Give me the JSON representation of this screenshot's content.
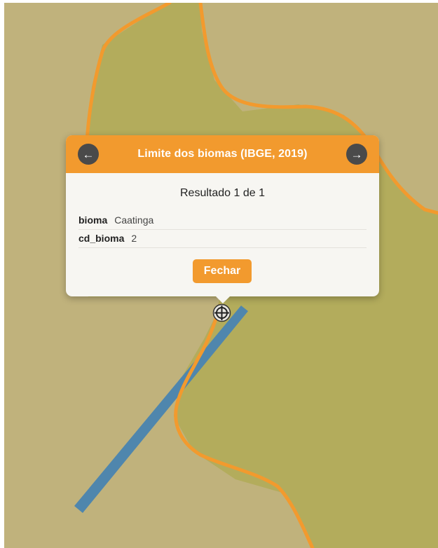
{
  "map": {
    "colors": {
      "background": "#c0b27c",
      "biome_fill": "#b3ac5c",
      "biome_border": "#f29a2e",
      "river": "#4f86ad"
    },
    "marker_icon": "target-crosshair-icon"
  },
  "popup": {
    "title": "Limite dos biomas (IBGE, 2019)",
    "prev_icon": "arrow-left-icon",
    "next_icon": "arrow-right-icon",
    "prev_glyph": "←",
    "next_glyph": "→",
    "result_count": "Resultado 1 de 1",
    "attributes": [
      {
        "key": "bioma",
        "value": "Caatinga"
      },
      {
        "key": "cd_bioma",
        "value": "2"
      }
    ],
    "close_label": "Fechar",
    "accent_color": "#f29a2e"
  }
}
